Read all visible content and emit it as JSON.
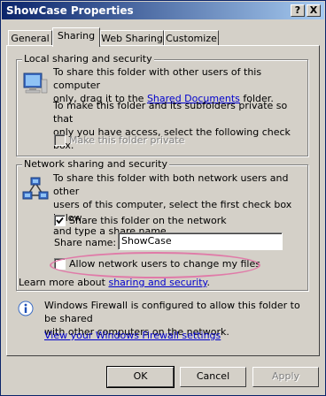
{
  "window": {
    "title": "ShowCase Properties",
    "help_label": "?",
    "close_label": "X"
  },
  "tabs": [
    {
      "label": "General"
    },
    {
      "label": "Sharing"
    },
    {
      "label": "Web Sharing"
    },
    {
      "label": "Customize"
    }
  ],
  "local": {
    "group_title": "Local sharing and security",
    "para1_line1": "To share this folder with other users of this computer",
    "para1_prefix": "only, drag it to the ",
    "para1_link": "Shared Documents",
    "para1_suffix": " folder.",
    "para2_line1": "To make this folder and its subfolders private so that",
    "para2_line2": "only you have access, select the following check box.",
    "private_label": "Make this folder private",
    "private_checked": false
  },
  "network": {
    "group_title": "Network sharing and security",
    "line1": "To share this folder with both network users and other",
    "line2": "users of this computer, select the first check box below",
    "line3": "and type a share name.",
    "share_label": "Share this folder on the network",
    "share_checked": true,
    "share_name_label": "Share name:",
    "share_name_value": "ShowCase",
    "allow_change_label": "Allow network users to change my files",
    "allow_change_checked": false,
    "learn_prefix": "Learn more about ",
    "learn_link": "sharing and security",
    "learn_suffix": "."
  },
  "firewall": {
    "line1": "Windows Firewall is configured to allow this folder to be shared",
    "line2": "with other computers on the network.",
    "link": "View your Windows Firewall settings"
  },
  "buttons": {
    "ok": "OK",
    "cancel": "Cancel",
    "apply": "Apply"
  }
}
